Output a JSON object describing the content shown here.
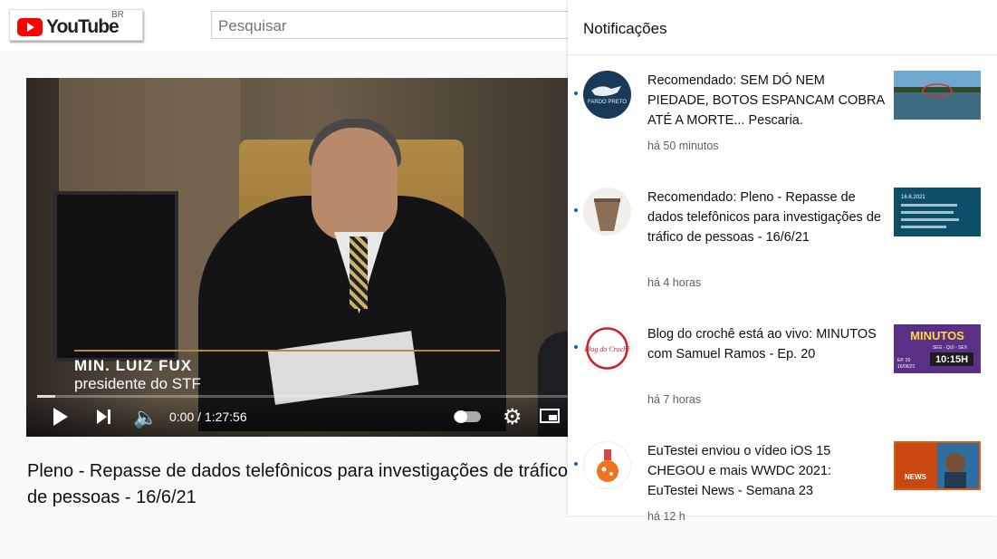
{
  "header": {
    "logo_text": "YouTube",
    "region": "BR",
    "search_placeholder": "Pesquisar"
  },
  "player": {
    "overlay_name": "MIN. LUIZ FUX",
    "overlay_role": "presidente do STF",
    "time": "0:00 / 1:27:56",
    "progress_fraction": 0.03
  },
  "video": {
    "title": "Pleno - Repasse de dados telefônicos para investigações de tráfico de pessoas - 16/6/21"
  },
  "notifications": {
    "title": "Notificações",
    "items": [
      {
        "text": "Recomendado: SEM DÓ NEM PIEDADE, BOTOS ESPANCAM COBRA ATÉ A MORTE... Pescaria.",
        "time": "há 50 minutos",
        "avatar_label": "FARDO PRETO"
      },
      {
        "text": "Recomendado: Pleno - Repasse de dados telefônicos para investigações de tráfico de pessoas - 16/6/21",
        "time": "há 4 horas",
        "thumb_label": "16.6.2021"
      },
      {
        "text": "Blog do crochê está ao vivo: MINUTOS com Samuel Ramos - Ep. 20",
        "time": "há 7 horas",
        "avatar_label": "Blog do Crochê",
        "thumb_title": "MINUTOS",
        "thumb_sub": "SEG - QUI - SEX",
        "thumb_ep": "EP. 20",
        "thumb_date": "16/06/21",
        "thumb_time": "10:15H"
      },
      {
        "text": "EuTestei enviou o vídeo iOS 15 CHEGOU e mais WWDC 2021: EuTestei News - Semana 23",
        "time": "há 12 h",
        "thumb_label": "NEWS"
      }
    ]
  },
  "colors": {
    "brand_red": "#ff0000",
    "unread_dot": "#065fd4"
  }
}
